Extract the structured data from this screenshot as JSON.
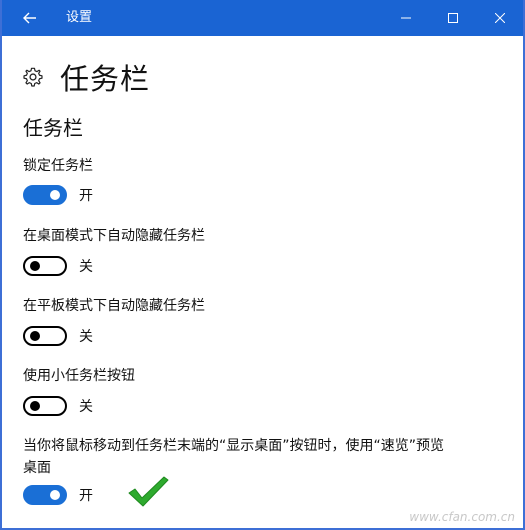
{
  "window": {
    "title": "设置",
    "titlebar_color": "#1a64d3",
    "controls": [
      "back-arrow-icon",
      "minimize-icon",
      "maximize-icon",
      "close-icon"
    ]
  },
  "page": {
    "icon": "gear-icon",
    "title": "任务栏",
    "section": "任务栏"
  },
  "settings": [
    {
      "label": "锁定任务栏",
      "state": "开",
      "on": true
    },
    {
      "label": "在桌面模式下自动隐藏任务栏",
      "state": "关",
      "on": false
    },
    {
      "label": "在平板模式下自动隐藏任务栏",
      "state": "关",
      "on": false
    },
    {
      "label": "使用小任务栏按钮",
      "state": "关",
      "on": false
    },
    {
      "label": "当你将鼠标移动到任务栏末端的“显示桌面”按钮时，使用“速览”预览桌面",
      "state": "开",
      "on": true
    }
  ],
  "annotation": {
    "icon": "green-checkmark-icon",
    "color": "#2eaa2e"
  },
  "watermark": "www.cfan.com.cn",
  "accent_color": "#1a6fd6"
}
